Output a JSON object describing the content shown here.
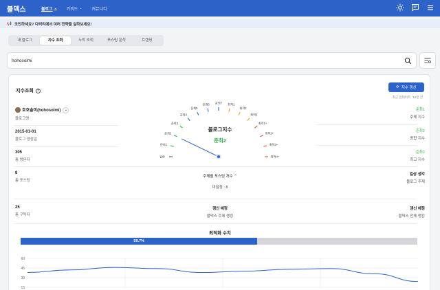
{
  "app": {
    "logo": "블덱스"
  },
  "nav": [
    {
      "label": "블로그",
      "active": true,
      "chevron": true
    },
    {
      "label": "키워드",
      "active": false,
      "chevron": true
    },
    {
      "label": "커뮤니티",
      "active": false,
      "chevron": false
    }
  ],
  "notice": {
    "text": "코인하세요? 다터리에서 여러 전략을 실하보세요!"
  },
  "tabs": [
    "내 블로그",
    "지수 조회",
    "누락 조회",
    "포스팅 분석",
    "트렌딩"
  ],
  "active_tab": 1,
  "search": {
    "value": "hohosolmi"
  },
  "card": {
    "title": "지수조회",
    "refresh_label": "지수 갱신",
    "update_text": "최근 업데이트: '18분 전"
  },
  "left": {
    "blog_name": "호호솔미(hohosolmi)",
    "blog_name_label": "블로그명",
    "created": "2015-01-01",
    "created_label": "블로그 생성일",
    "visitors": "305",
    "visitors_label": "총 방문자",
    "posts": "8",
    "posts_label": "총 포스팅",
    "subscribers": "25",
    "subscribers_label": "총 구독자"
  },
  "gauge": {
    "title": "블로그지수",
    "value": "준최2",
    "ticks": [
      "일반",
      "준최1",
      "준최2",
      "준최3",
      "준최4",
      "준최5",
      "준최6",
      "준최7",
      "최적1",
      "최적2",
      "최적3",
      "최적1+",
      "최적2+",
      "최적3+",
      "최적4+"
    ],
    "needle_index": 2
  },
  "right": {
    "topic_index": "준최1",
    "topic_index_label": "주제 지수",
    "total_index": "준최2",
    "total_index_label": "종합 지수",
    "max_index": "준최2",
    "max_index_label": "최고 지수",
    "topic": "일상·생각",
    "topic_label": "블로그 주제",
    "rank_all_label": "갱신 예정",
    "rank_all_sub": "블덱스 전체 랭킹"
  },
  "center": {
    "topic_posts_label": "주제별 포스팅 개수",
    "topic_posts_value": "미설정 : 8",
    "rank_topic_label": "갱신 예정",
    "rank_topic_sub": "블덱스 주제 랭킹"
  },
  "progress": {
    "title": "최적화 수치",
    "value": 59.7,
    "label": "59.7%"
  },
  "chart_data": {
    "type": "line",
    "y_ticks": [
      "60",
      "45",
      "30",
      "15"
    ],
    "ylim": [
      15,
      60
    ],
    "grid": true,
    "series": [
      {
        "values": [
          38,
          42,
          46,
          44,
          38,
          40,
          43,
          44,
          36,
          24
        ]
      }
    ]
  },
  "colors": {
    "brand": "#2d63c8",
    "green": "#35b34a",
    "red": "#e0503c"
  }
}
